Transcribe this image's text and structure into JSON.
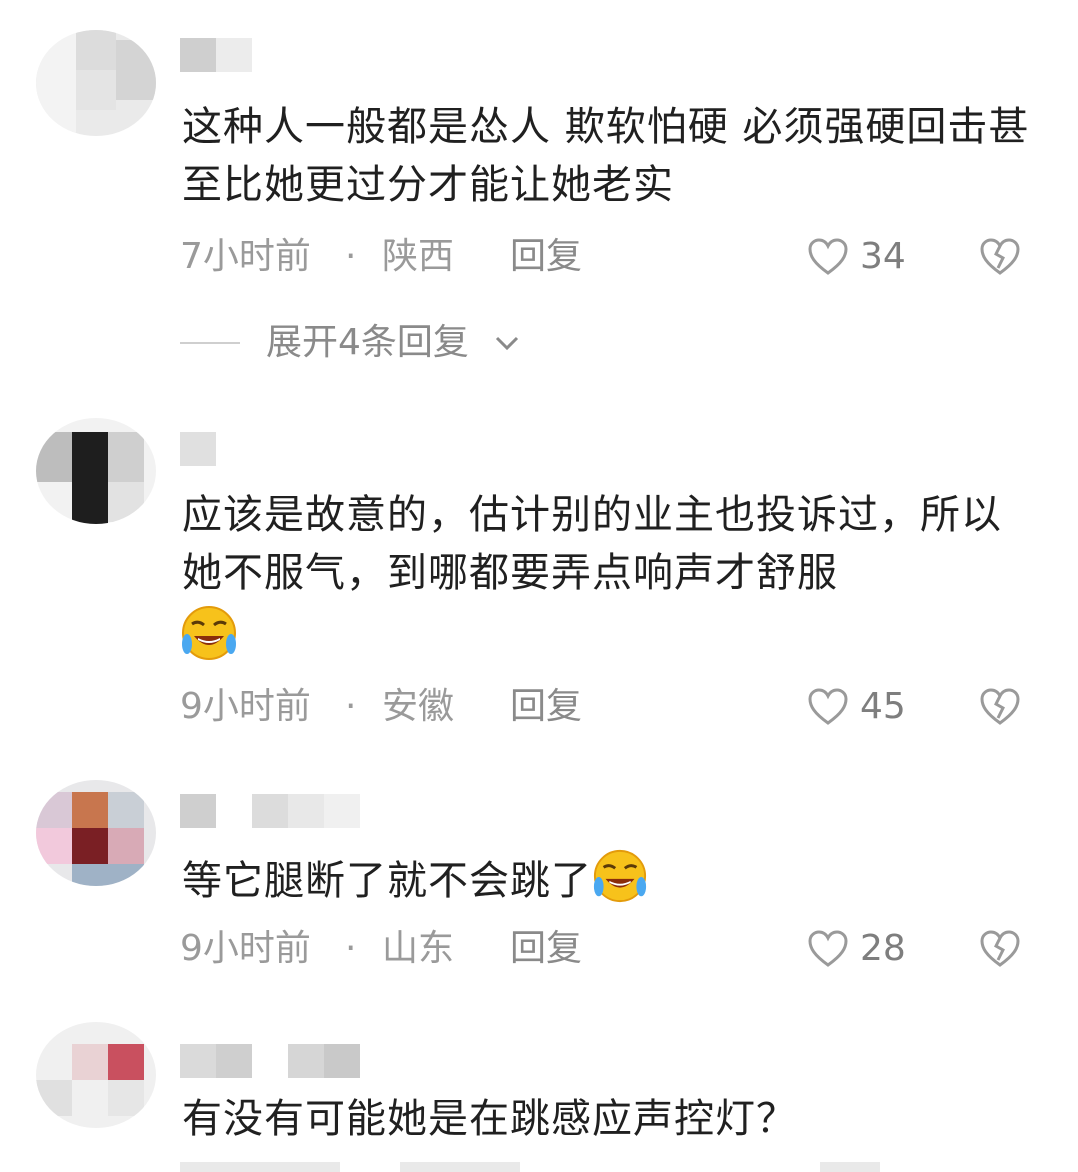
{
  "comments": [
    {
      "text": "这种人一般都是怂人 欺软怕硬 必须强硬回击甚至比她更过分才能让她老实",
      "time": "7小时前",
      "separator": "·",
      "location": "陕西",
      "reply_label": "回复",
      "likes": "34"
    },
    {
      "text": "应该是故意的，估计别的业主也投诉过，所以她不服气，到哪都要弄点响声才舒服",
      "emoji": "face-with-tears-of-joy",
      "time": "9小时前",
      "separator": "·",
      "location": "安徽",
      "reply_label": "回复",
      "likes": "45"
    },
    {
      "text": "等它腿断了就不会跳了",
      "emoji": "face-with-tears-of-joy",
      "time": "9小时前",
      "separator": "·",
      "location": "山东",
      "reply_label": "回复",
      "likes": "28"
    },
    {
      "text": "有没有可能她是在跳感应声控灯？"
    }
  ],
  "expand_replies": {
    "label": "展开4条回复"
  },
  "icons": {
    "like": "heart-outline-icon",
    "dislike": "broken-heart-icon",
    "expand": "chevron-down-icon"
  },
  "colors": {
    "text": "#202020",
    "meta": "#9a9a9a",
    "background": "#ffffff"
  }
}
